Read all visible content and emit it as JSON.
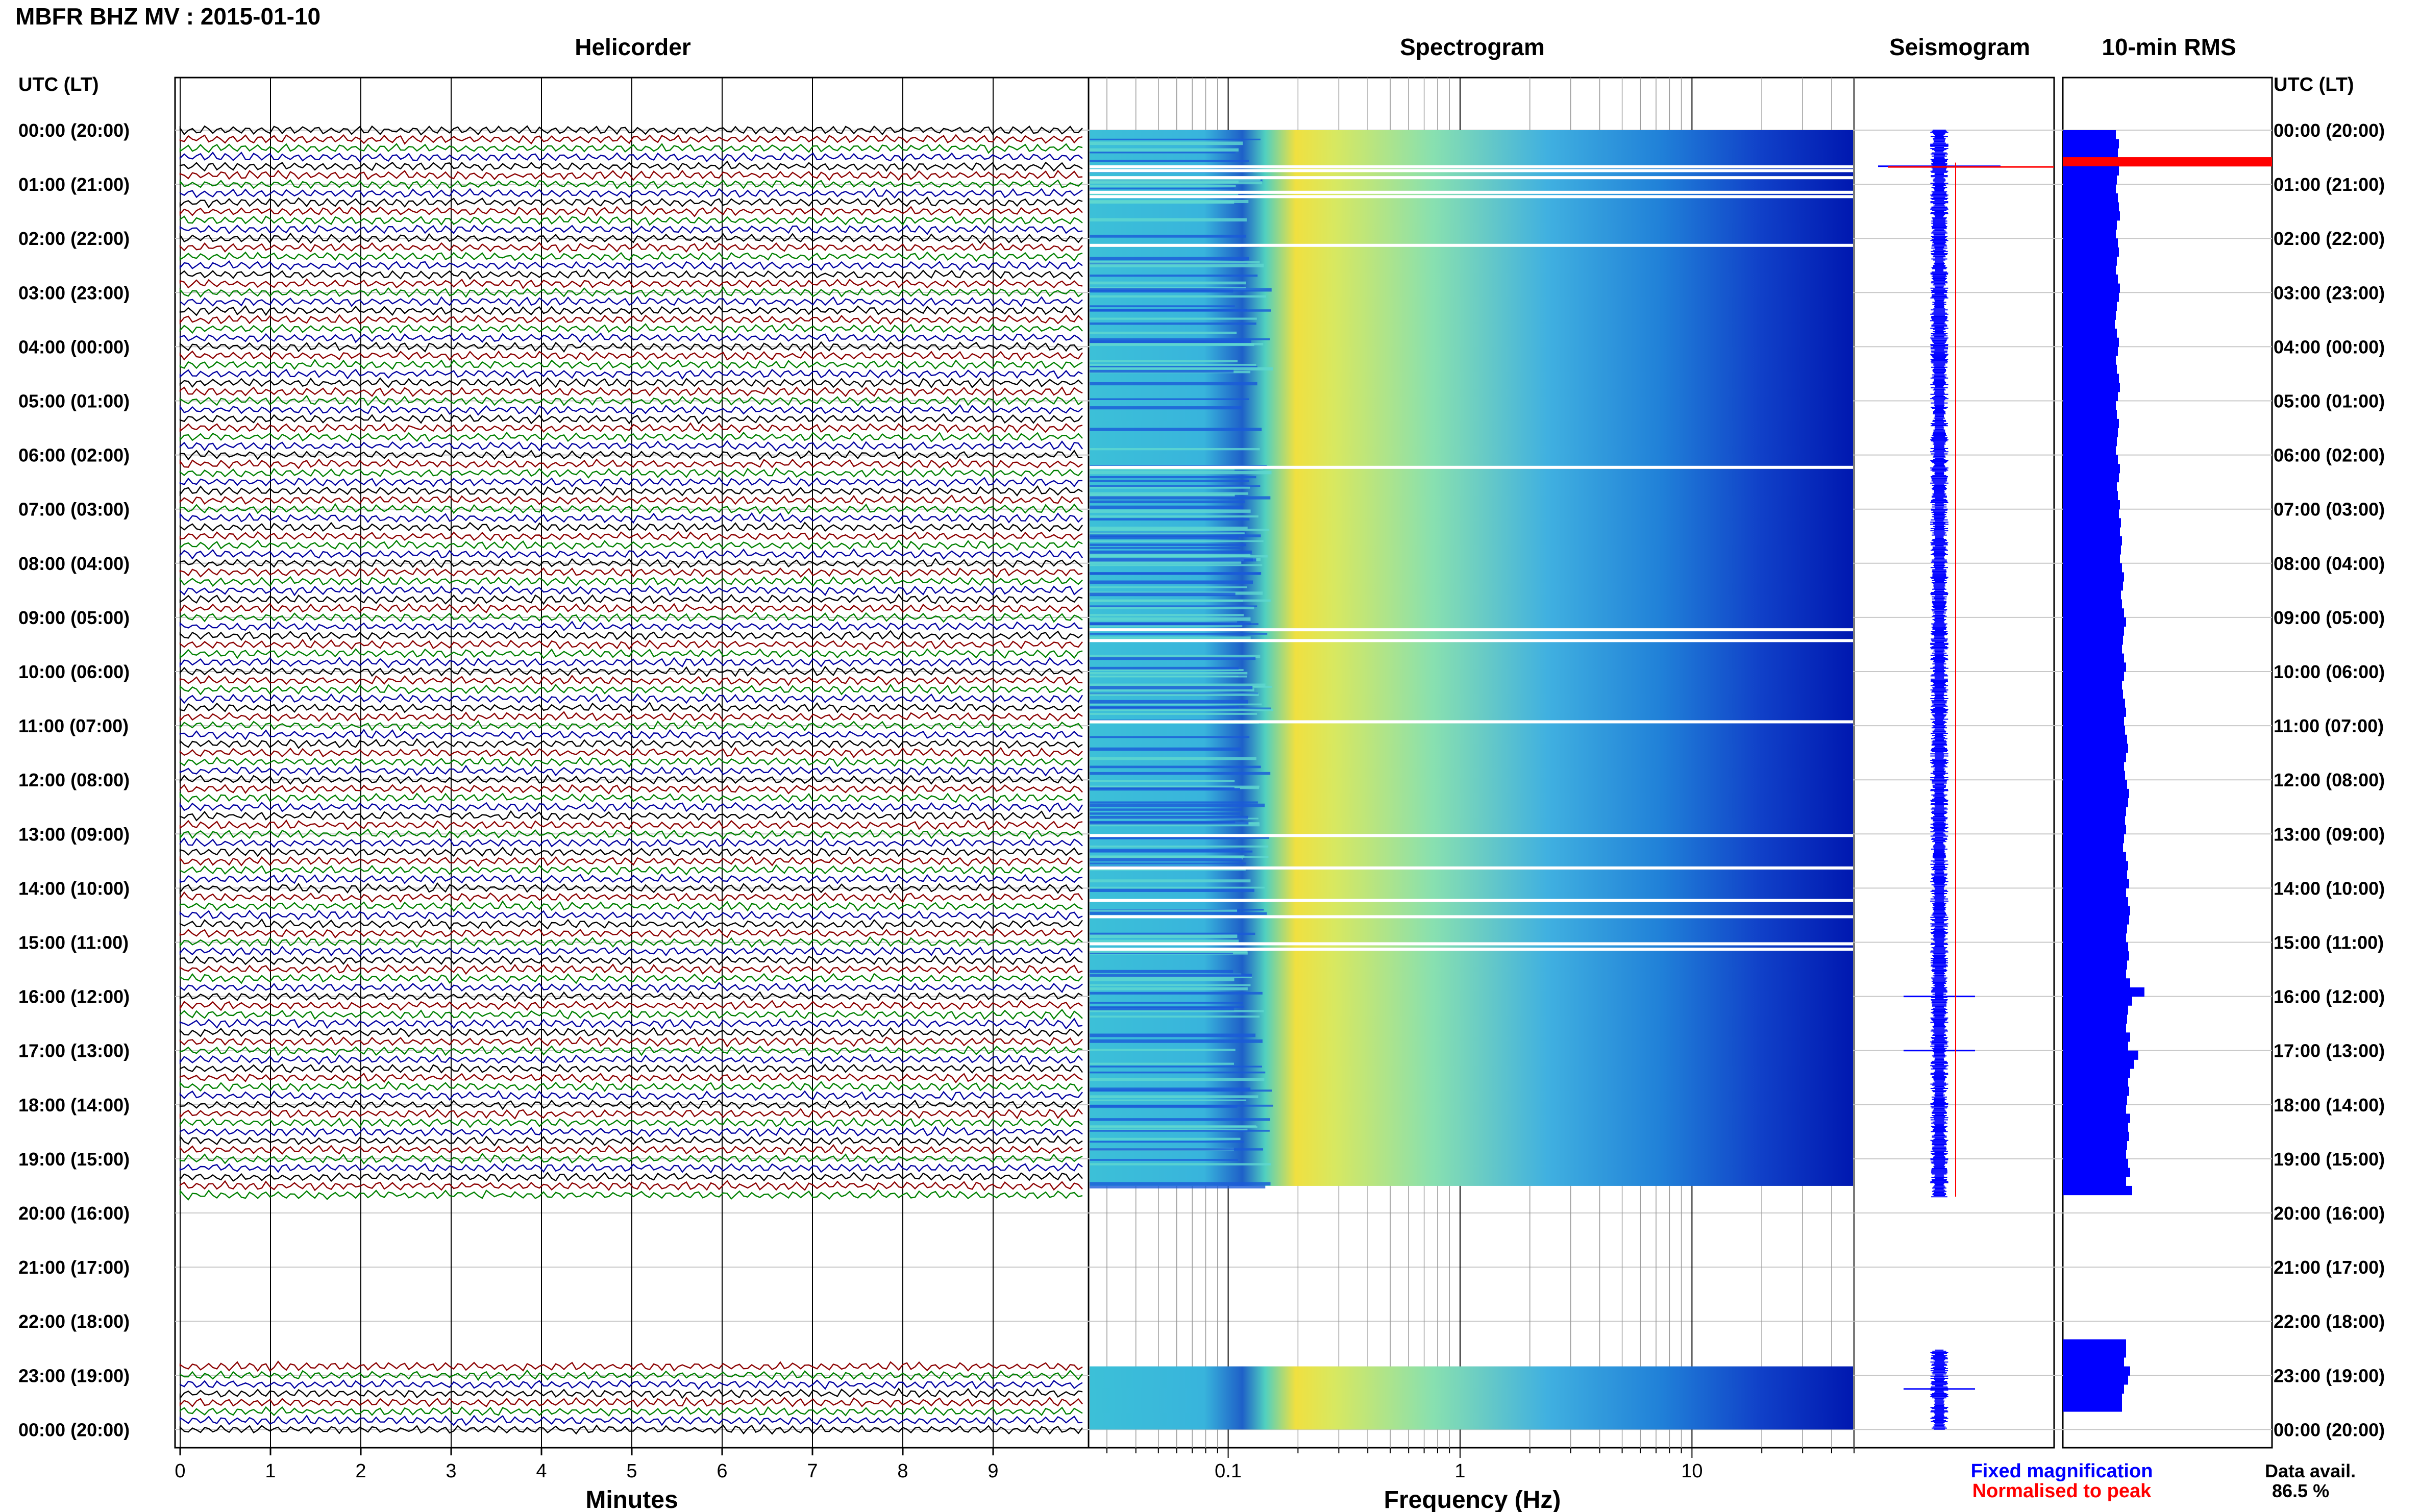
{
  "header": {
    "title": "MBFR BHZ MV : 2015-01-10",
    "time_label_left": "UTC (LT)",
    "time_label_right": "UTC (LT)"
  },
  "panels": {
    "helicorder": "Helicorder",
    "spectrogram": "Spectrogram",
    "seismogram": "Seismogram",
    "rms": "10-min RMS"
  },
  "axes": {
    "helicorder_xlabel": "Minutes",
    "spectrogram_xlabel": "Frequency (Hz)"
  },
  "legend": {
    "fixed": "Fixed magnification",
    "normalised": "Normalised to peak",
    "fixed_color": "#0000ff",
    "normalised_color": "#ff0000"
  },
  "availability": {
    "label": "Data avail.",
    "value": "86.5 %"
  },
  "colors": {
    "trace_cycle": [
      "#000000",
      "#8b0000",
      "#008000",
      "#0000a0"
    ],
    "rms_bar": "#0000ff",
    "rms_peak": "#ff0000",
    "spectrogram_low": "#0030c8",
    "spectrogram_mid": "#40c8e0",
    "spectrogram_high": "#f0e040"
  },
  "chart_data": [
    {
      "type": "line",
      "title": "Helicorder",
      "xlabel": "Minutes",
      "ylabel": "UTC (LT)",
      "x_ticks": [
        "0",
        "1",
        "2",
        "3",
        "4",
        "5",
        "6",
        "7",
        "8",
        "9"
      ],
      "xlim": [
        0,
        10
      ],
      "y_ticks": [
        "00:00 (20:00)",
        "01:00 (21:00)",
        "02:00 (22:00)",
        "03:00 (23:00)",
        "04:00 (00:00)",
        "05:00 (01:00)",
        "06:00 (02:00)",
        "07:00 (03:00)",
        "08:00 (04:00)",
        "09:00 (05:00)",
        "10:00 (06:00)",
        "11:00 (07:00)",
        "12:00 (08:00)",
        "13:00 (09:00)",
        "14:00 (10:00)",
        "15:00 (11:00)",
        "16:00 (12:00)",
        "17:00 (13:00)",
        "18:00 (14:00)",
        "19:00 (15:00)",
        "20:00 (16:00)",
        "21:00 (17:00)",
        "22:00 (18:00)",
        "23:00 (19:00)",
        "00:00 (20:00)"
      ],
      "trace_minutes_per_line": 10,
      "data_gap_utc": [
        "19:40",
        "22:50"
      ]
    },
    {
      "type": "heatmap",
      "title": "Spectrogram",
      "xlabel": "Frequency (Hz)",
      "x_scale": "log",
      "x_ticks": [
        "0.1",
        "1",
        "10"
      ],
      "xlim": [
        0.025,
        50
      ],
      "dominant_band_hz": [
        0.15,
        0.35
      ],
      "data_gap_utc": [
        "19:30",
        "22:50"
      ]
    },
    {
      "type": "line",
      "title": "Seismogram",
      "series": [
        {
          "name": "Fixed magnification",
          "color": "#0000ff"
        },
        {
          "name": "Normalised to peak",
          "color": "#ff0000"
        }
      ],
      "events_utc": [
        "00:40",
        "16:00",
        "17:00",
        "23:15"
      ]
    },
    {
      "type": "bar",
      "title": "10-min RMS",
      "orientation": "horizontal",
      "interval_minutes": 10,
      "values": [
        0.52,
        0.55,
        0.54,
        1.0,
        0.55,
        0.53,
        0.52,
        0.54,
        0.55,
        0.56,
        0.53,
        0.52,
        0.54,
        0.55,
        0.53,
        0.52,
        0.54,
        0.56,
        0.55,
        0.53,
        0.52,
        0.51,
        0.53,
        0.55,
        0.54,
        0.52,
        0.53,
        0.55,
        0.56,
        0.54,
        0.52,
        0.53,
        0.55,
        0.54,
        0.53,
        0.52,
        0.54,
        0.56,
        0.55,
        0.53,
        0.54,
        0.56,
        0.55,
        0.57,
        0.56,
        0.58,
        0.57,
        0.56,
        0.58,
        0.6,
        0.59,
        0.57,
        0.58,
        0.6,
        0.62,
        0.6,
        0.59,
        0.58,
        0.6,
        0.62,
        0.6,
        0.58,
        0.59,
        0.61,
        0.62,
        0.6,
        0.61,
        0.63,
        0.64,
        0.62,
        0.6,
        0.61,
        0.63,
        0.65,
        0.64,
        0.62,
        0.61,
        0.62,
        0.6,
        0.59,
        0.62,
        0.64,
        0.63,
        0.65,
        0.62,
        0.64,
        0.66,
        0.65,
        0.63,
        0.62,
        0.64,
        0.65,
        0.63,
        0.62,
        0.66,
        0.8,
        0.68,
        0.64,
        0.63,
        0.62,
        0.66,
        0.64,
        0.74,
        0.7,
        0.66,
        0.64,
        0.65,
        0.63,
        0.62,
        0.66,
        0.64,
        0.65,
        0.63,
        0.62,
        0.64,
        0.66,
        0.62,
        0.68,
        null,
        null,
        null,
        null,
        null,
        null,
        null,
        null,
        null,
        null,
        null,
        null,
        null,
        null,
        null,
        null,
        0.62,
        0.62,
        0.6,
        0.66,
        0.64,
        0.6,
        0.58,
        0.58
      ],
      "peak_utc": "00:40"
    }
  ]
}
